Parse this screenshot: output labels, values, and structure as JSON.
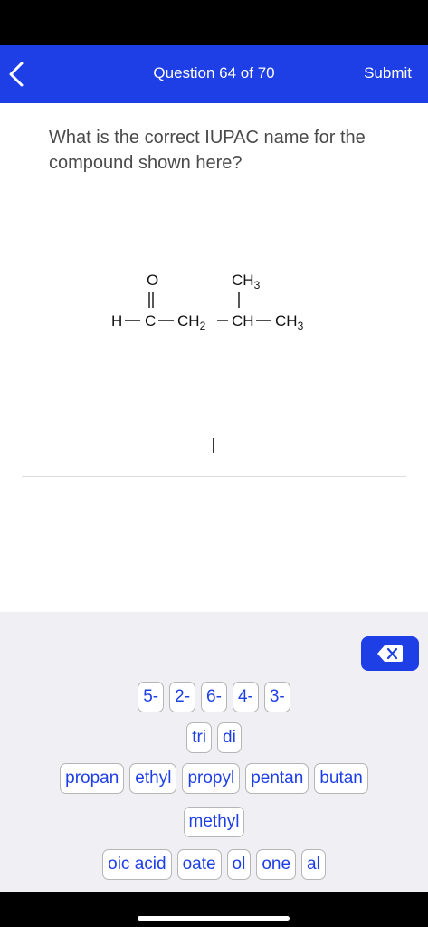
{
  "header": {
    "title": "Question 64 of 70",
    "submit_label": "Submit",
    "back_icon": "chevron-left-icon"
  },
  "question": {
    "text": "What is the correct IUPAC name for the compound shown here?"
  },
  "structure": {
    "top_left": "O",
    "top_right_base": "CH",
    "top_right_sub": "3",
    "chain_h": "H",
    "chain_c": "C",
    "chain_ch2_base": "CH",
    "chain_ch2_sub": "2",
    "chain_ch": "CH",
    "chain_ch3_base": "CH",
    "chain_ch3_sub": "3"
  },
  "keyboard": {
    "delete_icon": "backspace-icon",
    "row1": [
      "5-",
      "2-",
      "6-",
      "4-",
      "3-"
    ],
    "row2": [
      "tri",
      "di"
    ],
    "row3": [
      "propan",
      "ethyl",
      "propyl",
      "pentan",
      "butan"
    ],
    "row4": [
      "methyl"
    ],
    "row5": [
      "oic acid",
      "oate",
      "ol",
      "one",
      "al"
    ]
  },
  "colors": {
    "accent": "#1e3fe6",
    "keyboard_bg": "#efeff4"
  }
}
